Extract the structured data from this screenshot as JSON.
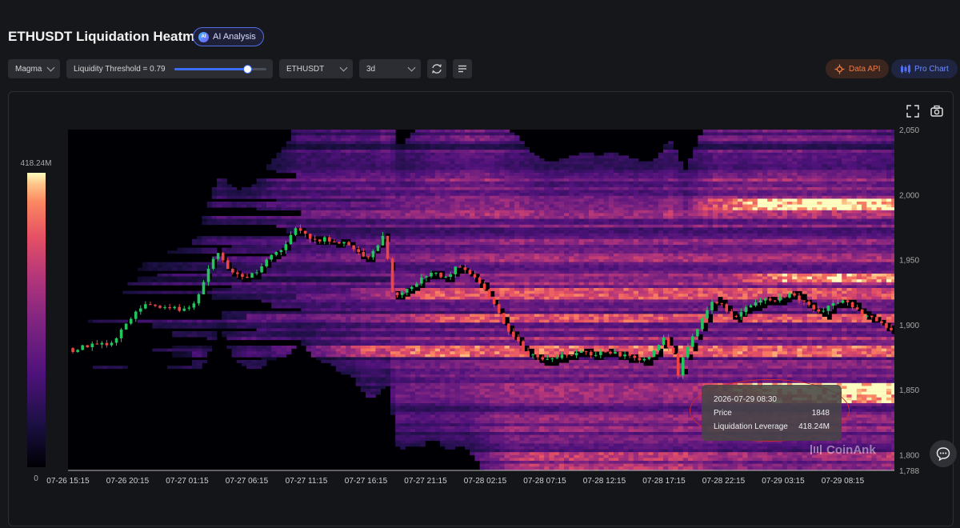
{
  "header": {
    "title": "ETHUSDT Liquidation Heatmap",
    "ai_label": "AI Analysis",
    "ai_icon": "ai-chip-icon"
  },
  "controls": {
    "colormap": "Magma",
    "threshold_label": "Liquidity Threshold = 0.79",
    "threshold_value": 0.79,
    "symbol": "ETHUSDT",
    "timeframe": "3d",
    "data_api_label": "Data API",
    "pro_chart_label": "Pro Chart"
  },
  "colors": {
    "data_api": "#ef7b45",
    "pro_chart": "#4f6ef2",
    "up": "#22c55e",
    "down": "#ef4444",
    "accent": "#3d6df2"
  },
  "chart_data": {
    "type": "heatmap",
    "title": "",
    "x_ticks": [
      "07-26 15:15",
      "07-26 20:15",
      "07-27 01:15",
      "07-27 06:15",
      "07-27 11:15",
      "07-27 16:15",
      "07-27 21:15",
      "07-28 02:15",
      "07-28 07:15",
      "07-28 12:15",
      "07-28 17:15",
      "07-28 22:15",
      "07-29 03:15",
      "07-29 08:15"
    ],
    "y_ticks": [
      "2,050",
      "2,000",
      "1,950",
      "1,900",
      "1,850",
      "1,800",
      "1,788"
    ],
    "ylim": [
      1788,
      2050
    ],
    "colorbar": {
      "max_label": "418.24M",
      "min_label": "0"
    },
    "price_path": [
      {
        "t": 0,
        "p": 1882
      },
      {
        "t": 0.5,
        "p": 1880
      },
      {
        "t": 1,
        "p": 1882
      },
      {
        "t": 2,
        "p": 1884
      },
      {
        "t": 3,
        "p": 1886
      },
      {
        "t": 4,
        "p": 1883
      },
      {
        "t": 5,
        "p": 1891
      },
      {
        "t": 6,
        "p": 1903
      },
      {
        "t": 7,
        "p": 1910
      },
      {
        "t": 8,
        "p": 1918
      },
      {
        "t": 9,
        "p": 1912
      },
      {
        "t": 10,
        "p": 1913
      },
      {
        "t": 11,
        "p": 1912
      },
      {
        "t": 12,
        "p": 1911
      },
      {
        "t": 13,
        "p": 1920
      },
      {
        "t": 14,
        "p": 1940
      },
      {
        "t": 15,
        "p": 1958
      },
      {
        "t": 16,
        "p": 1945
      },
      {
        "t": 17,
        "p": 1938
      },
      {
        "t": 18,
        "p": 1937
      },
      {
        "t": 19,
        "p": 1940
      },
      {
        "t": 20,
        "p": 1950
      },
      {
        "t": 21,
        "p": 1955
      },
      {
        "t": 22,
        "p": 1962
      },
      {
        "t": 23,
        "p": 1975
      },
      {
        "t": 24,
        "p": 1968
      },
      {
        "t": 25,
        "p": 1965
      },
      {
        "t": 26,
        "p": 1966
      },
      {
        "t": 27,
        "p": 1962
      },
      {
        "t": 28,
        "p": 1965
      },
      {
        "t": 29,
        "p": 1957
      },
      {
        "t": 30,
        "p": 1950
      },
      {
        "t": 31,
        "p": 1960
      },
      {
        "t": 32,
        "p": 1970
      },
      {
        "t": 32.5,
        "p": 1930
      },
      {
        "t": 33,
        "p": 1920
      },
      {
        "t": 34,
        "p": 1928
      },
      {
        "t": 35,
        "p": 1930
      },
      {
        "t": 36,
        "p": 1938
      },
      {
        "t": 37,
        "p": 1940
      },
      {
        "t": 38,
        "p": 1935
      },
      {
        "t": 39,
        "p": 1944
      },
      {
        "t": 40,
        "p": 1942
      },
      {
        "t": 41,
        "p": 1935
      },
      {
        "t": 42,
        "p": 1928
      },
      {
        "t": 43,
        "p": 1915
      },
      {
        "t": 44,
        "p": 1900
      },
      {
        "t": 45,
        "p": 1890
      },
      {
        "t": 46,
        "p": 1880
      },
      {
        "t": 47,
        "p": 1875
      },
      {
        "t": 48,
        "p": 1872
      },
      {
        "t": 49,
        "p": 1874
      },
      {
        "t": 50,
        "p": 1876
      },
      {
        "t": 51,
        "p": 1878
      },
      {
        "t": 52,
        "p": 1880
      },
      {
        "t": 53,
        "p": 1877
      },
      {
        "t": 54,
        "p": 1879
      },
      {
        "t": 55,
        "p": 1878
      },
      {
        "t": 56,
        "p": 1876
      },
      {
        "t": 57,
        "p": 1874
      },
      {
        "t": 58,
        "p": 1872
      },
      {
        "t": 59,
        "p": 1878
      },
      {
        "t": 60,
        "p": 1890
      },
      {
        "t": 61,
        "p": 1878
      },
      {
        "t": 61.5,
        "p": 1862
      },
      {
        "t": 62,
        "p": 1874
      },
      {
        "t": 63,
        "p": 1890
      },
      {
        "t": 64,
        "p": 1905
      },
      {
        "t": 65,
        "p": 1920
      },
      {
        "t": 66,
        "p": 1915
      },
      {
        "t": 67,
        "p": 1905
      },
      {
        "t": 68,
        "p": 1912
      },
      {
        "t": 69,
        "p": 1915
      },
      {
        "t": 70,
        "p": 1920
      },
      {
        "t": 71,
        "p": 1918
      },
      {
        "t": 72,
        "p": 1921
      },
      {
        "t": 73,
        "p": 1925
      },
      {
        "t": 74,
        "p": 1918
      },
      {
        "t": 75,
        "p": 1912
      },
      {
        "t": 76,
        "p": 1908
      },
      {
        "t": 77,
        "p": 1916
      },
      {
        "t": 78,
        "p": 1918
      },
      {
        "t": 79,
        "p": 1915
      },
      {
        "t": 80,
        "p": 1908
      },
      {
        "t": 81,
        "p": 1905
      },
      {
        "t": 82,
        "p": 1900
      },
      {
        "t": 83,
        "p": 1895
      }
    ]
  },
  "tooltip": {
    "time": "2026-07-29 08:30",
    "price_label": "Price",
    "price_value": "1848",
    "lev_label": "Liquidation Leverage",
    "lev_value": "418.24M"
  },
  "watermark": "CoinAnk",
  "icons": {
    "fullscreen": "fullscreen-icon",
    "camera": "camera-icon",
    "refresh": "refresh-icon",
    "list": "list-icon",
    "chat": "chat-icon"
  }
}
